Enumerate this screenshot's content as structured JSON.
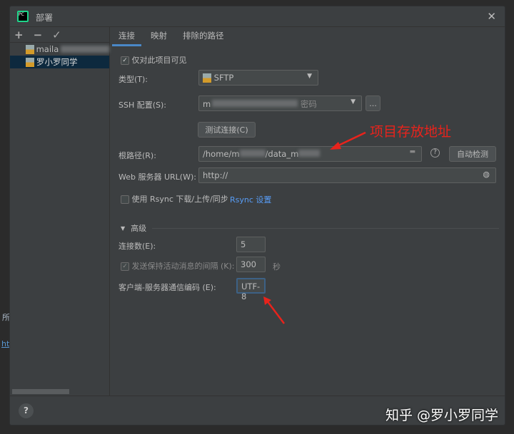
{
  "background": {
    "left_text_1": "所",
    "left_link": "ht"
  },
  "dialog": {
    "title": "部署",
    "close_icon": "close-icon"
  },
  "tree": {
    "toolbar": [
      "+",
      "−",
      "✓"
    ],
    "items": [
      {
        "label": "maila",
        "selected": false
      },
      {
        "label": "罗小罗同学",
        "selected": true
      }
    ]
  },
  "tabs": [
    {
      "label": "连接",
      "active": true
    },
    {
      "label": "映射",
      "active": false
    },
    {
      "label": "排除的路径",
      "active": false
    }
  ],
  "form": {
    "visible_only": {
      "label": "仅对此项目可见",
      "checked": true
    },
    "type": {
      "label": "类型(T):",
      "value": "SFTP"
    },
    "ssh": {
      "label": "SSH 配置(S):",
      "value_prefix": "m",
      "suffix": "密码",
      "more_label": "..."
    },
    "test_button": "测试连接(C)",
    "root": {
      "label": "根路径(R):",
      "value_a": "/home/m",
      "value_b": "/data_m",
      "autodetect": "自动检测"
    },
    "web": {
      "label": "Web 服务器 URL(W):",
      "value": "http://"
    },
    "rsync": {
      "label": "使用 Rsync 下载/上传/同步",
      "checked": false,
      "link": "Rsync 设置"
    },
    "advanced": {
      "label": "高级",
      "connections": {
        "label": "连接数(E):",
        "value": "5"
      },
      "keepalive": {
        "label": "发送保持活动消息的间隔 (K):",
        "value": "300",
        "unit": "秒",
        "checked": true
      },
      "encoding": {
        "label": "客户端-服务器通信编码 (E):",
        "value": "UTF-8"
      }
    }
  },
  "annotation": {
    "text": "项目存放地址",
    "color": "#e8231c"
  },
  "footer": {
    "help": "?"
  },
  "watermark": "知乎 @罗小罗同学"
}
